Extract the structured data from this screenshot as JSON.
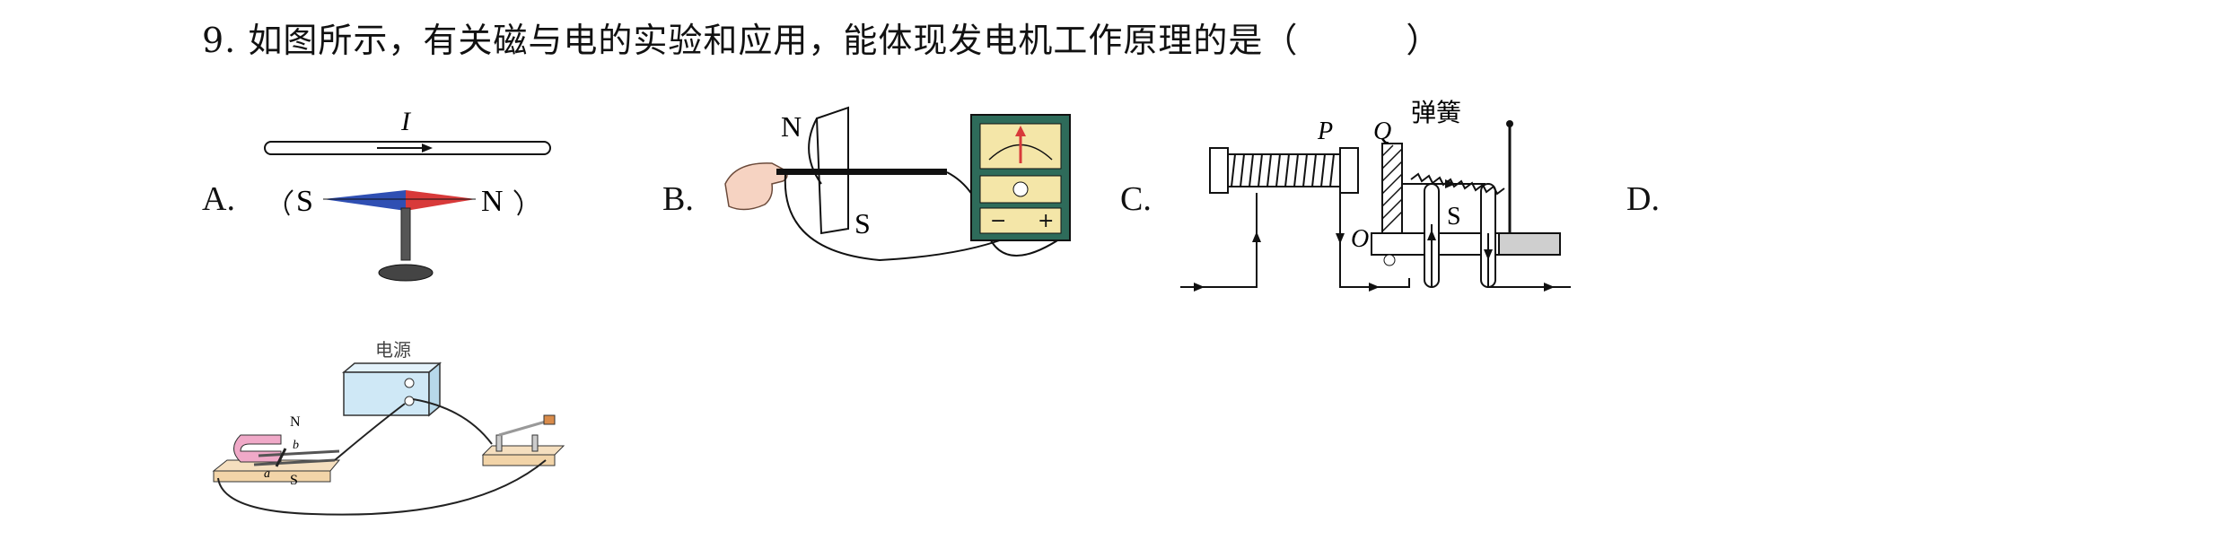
{
  "question": {
    "number": "9.",
    "stem_before_blank": "如图所示，有关磁与电的实验和应用，能体现发电机工作原理的是（",
    "stem_after_blank": "）"
  },
  "options": {
    "A": {
      "label": "A.",
      "current_label": "I",
      "pole_s": "S",
      "pole_n": "N"
    },
    "B": {
      "label": "B.",
      "pole_n": "N",
      "pole_s": "S"
    },
    "C": {
      "label": "C.",
      "label_p": "P",
      "label_q": "Q",
      "label_o": "O",
      "label_s": "S",
      "spring_label": "弹簧"
    },
    "D": {
      "label": "D.",
      "power_label": "电源",
      "pole_n": "N",
      "pole_s": "S",
      "label_a": "a",
      "label_b": "b"
    }
  },
  "colors": {
    "magnet_red": "#d83a3a",
    "magnet_blue": "#2f4fb3",
    "meter_green": "#2e6b5a",
    "meter_face": "#f4e6a8",
    "wood": "#f2d4a8",
    "power_box": "#cfe8f6",
    "pink_magnet": "#f0a9c8"
  }
}
